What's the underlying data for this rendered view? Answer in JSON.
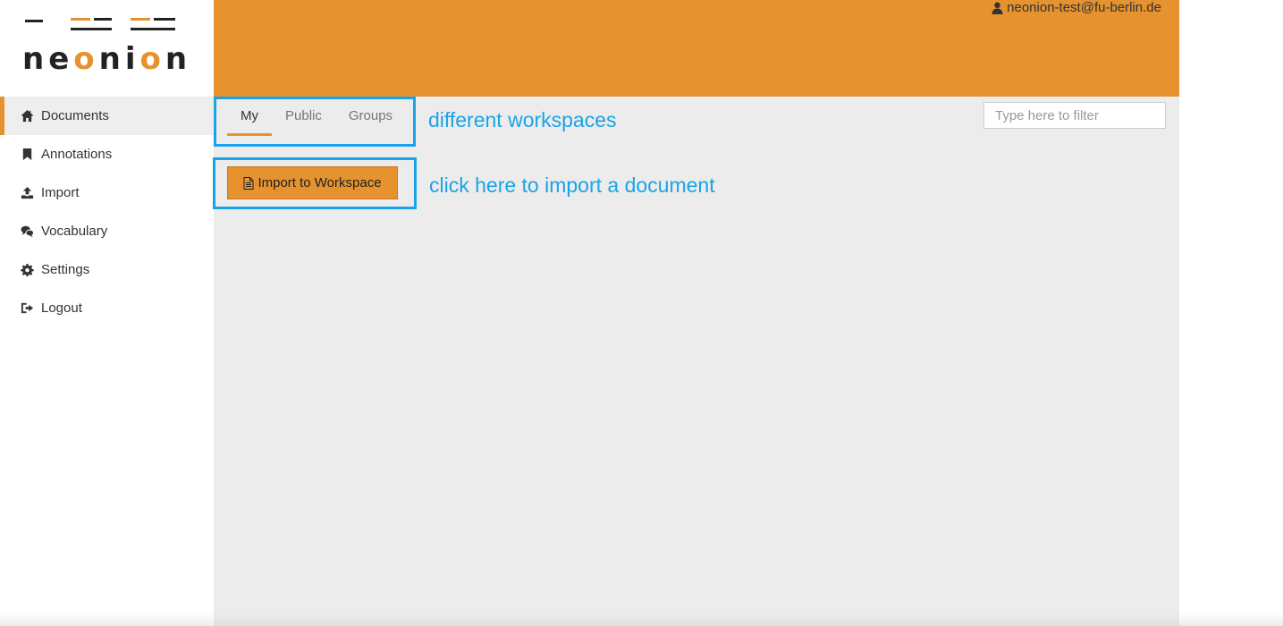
{
  "app": {
    "brand": "neonion",
    "brand_parts": [
      "ne",
      "o",
      "ni",
      "o",
      "n"
    ]
  },
  "colors": {
    "accent": "#e6922f",
    "annotation": "#1aa3e8",
    "main_bg": "#ececec"
  },
  "header": {
    "user_icon": "user-icon",
    "user_email": "neonion-test@fu-berlin.de"
  },
  "sidebar": {
    "items": [
      {
        "label": "Documents",
        "icon": "home-icon",
        "active": true
      },
      {
        "label": "Annotations",
        "icon": "bookmark-icon",
        "active": false
      },
      {
        "label": "Import",
        "icon": "upload-icon",
        "active": false
      },
      {
        "label": "Vocabulary",
        "icon": "comments-icon",
        "active": false
      },
      {
        "label": "Settings",
        "icon": "gear-icon",
        "active": false
      },
      {
        "label": "Logout",
        "icon": "sign-out-icon",
        "active": false
      }
    ]
  },
  "main": {
    "tabs": [
      {
        "label": "My",
        "active": true
      },
      {
        "label": "Public",
        "active": false
      },
      {
        "label": "Groups",
        "active": false
      }
    ],
    "import_button_label": "Import to Workspace",
    "import_button_icon": "file-icon",
    "filter_placeholder": "Type here to filter",
    "filter_value": ""
  },
  "annotations": {
    "tabs_note": "different workspaces",
    "import_note": "click here to import a document"
  }
}
